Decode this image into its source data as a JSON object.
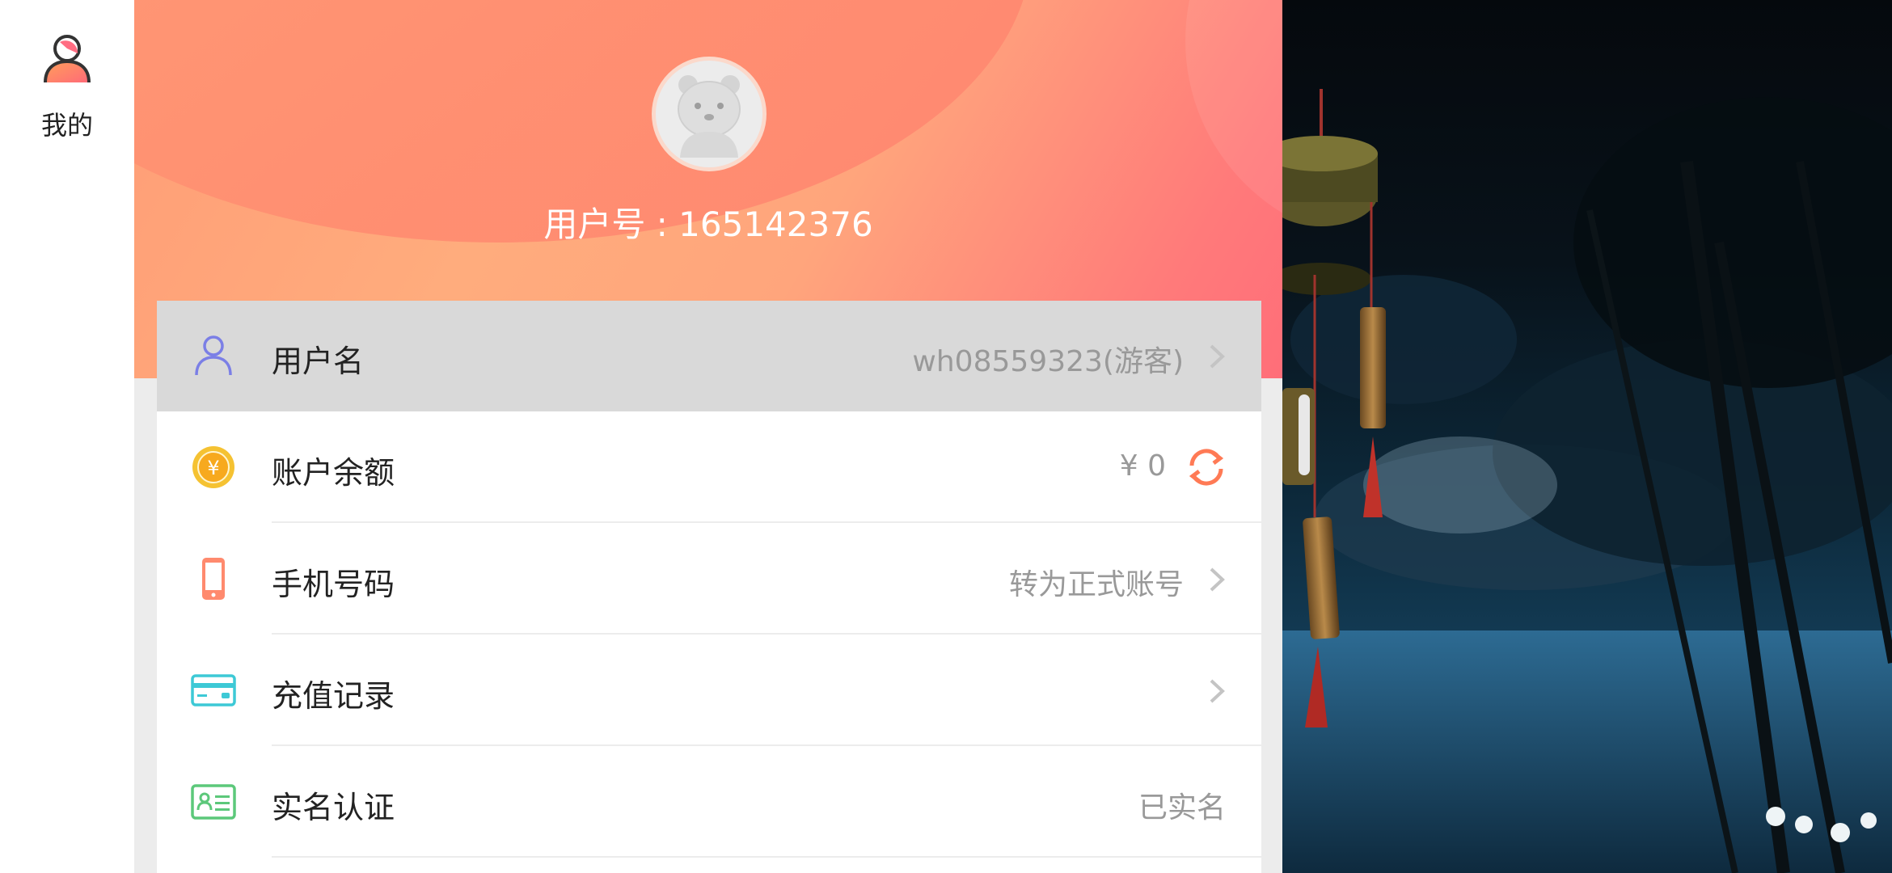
{
  "rail": {
    "tab_label": "我的"
  },
  "header": {
    "user_id_text": "用户号 : 165142376"
  },
  "rows": [
    {
      "label": "用户名",
      "value": "wh08559323(游客)",
      "icon": "user-icon"
    },
    {
      "label": "账户余额",
      "value": "¥ 0",
      "icon": "coin-icon"
    },
    {
      "label": "手机号码",
      "value": "转为正式账号",
      "icon": "phone-icon"
    },
    {
      "label": "充值记录",
      "value": "",
      "icon": "card-icon"
    },
    {
      "label": "实名认证",
      "value": "已实名",
      "icon": "id-card-icon"
    }
  ],
  "colors": {
    "accent": "#ff7a6e",
    "user_icon": "#7b7fe6",
    "coin": "#f5c232",
    "phone": "#ff7f6a",
    "card": "#3dc9d6",
    "idcard": "#5cc87a"
  }
}
